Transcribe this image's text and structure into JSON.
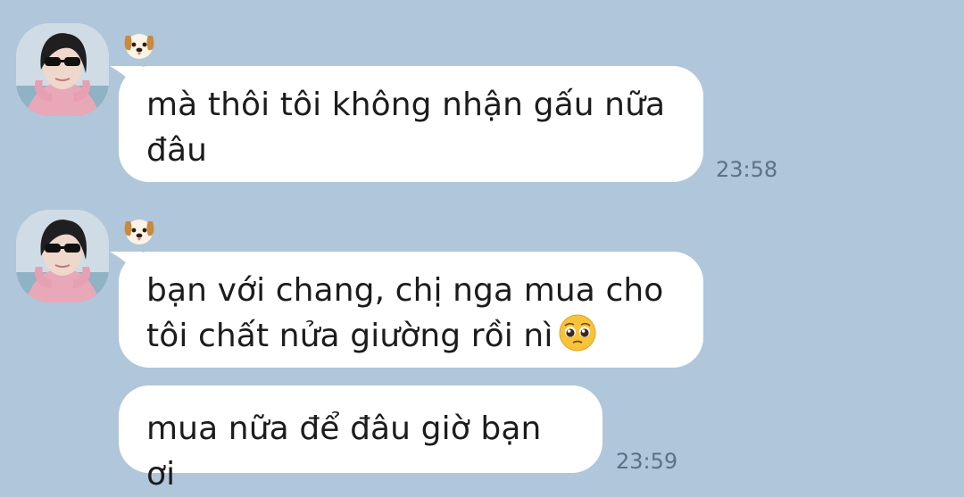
{
  "chat": {
    "messages": [
      {
        "sender_emoji": "dog-face-icon",
        "lines": [
          "mà thôi tôi không nhận gấu nữa",
          "đâu"
        ],
        "time": "23:58"
      },
      {
        "sender_emoji": "dog-face-icon",
        "lines": [
          "bạn với chang, chị nga mua cho",
          "tôi chất nửa giường rồi nì"
        ],
        "inline_emoji": "pleading-face-icon"
      },
      {
        "lines": [
          "mua nữa để đâu giờ bạn ơi"
        ],
        "time": "23:59"
      }
    ]
  },
  "colors": {
    "background": "#b0c6da",
    "bubble": "#ffffff",
    "text": "#1c1c1c",
    "timestamp": "#5e7182"
  }
}
